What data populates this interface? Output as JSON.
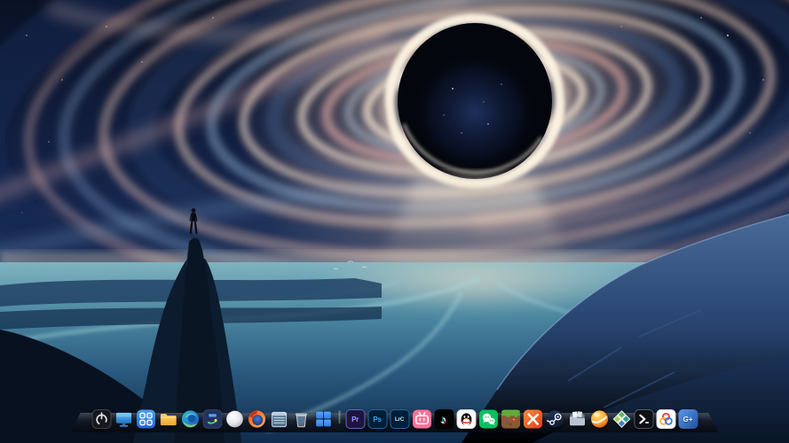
{
  "wallpaper": {
    "description": "Interstellar-style painted black hole with swirling pink and cream accretion disk over a blue valley; lone human silhouette standing on a rock spire at left, dark mountains at right",
    "colors": {
      "sky": "#101c38",
      "accretion_pink": "#e8a9a5",
      "accretion_cream": "#f6e9d4",
      "accretion_blue": "#9dbede",
      "black_hole_core": "#04060d",
      "horizon_glow": "#ead9c2",
      "water": "#4d89a2",
      "mountains": "#22406b",
      "silhouette": "#070c16"
    }
  },
  "dock": {
    "background": "rgba(18,22,32,0.88)",
    "items": [
      {
        "id": "power",
        "label": "Power",
        "color": "#17181d"
      },
      {
        "id": "this-pc",
        "label": "Computer Display",
        "color": "#3aa0e8"
      },
      {
        "id": "launcher",
        "label": "App Launcher",
        "color": "#2f7ce0"
      },
      {
        "id": "file-explorer",
        "label": "File Explorer",
        "color": "#f5b942"
      },
      {
        "id": "edge",
        "label": "Microsoft Edge",
        "color": "#1b6fd4"
      },
      {
        "id": "media-player",
        "label": "Media Player",
        "color": "#20335e"
      },
      {
        "id": "white-sphere",
        "label": "Sphere App",
        "color": "#e8eaee"
      },
      {
        "id": "firefox",
        "label": "Firefox Browser",
        "color": "#ff7f27"
      },
      {
        "id": "cabinet",
        "label": "Cabinet Utility",
        "color": "#9ecbe8"
      },
      {
        "id": "recycle-bin",
        "label": "Recycle Bin",
        "color": "#bdd3e2"
      },
      {
        "id": "windows",
        "label": "Windows",
        "color": "#3b82e8"
      },
      {
        "id": "premiere",
        "label": "Adobe Premiere Pro",
        "glyph": "Pr",
        "color": "#9b9bff",
        "bg": "#1d1540"
      },
      {
        "id": "photoshop",
        "label": "Adobe Photoshop",
        "glyph": "Ps",
        "color": "#31a8ff",
        "bg": "#001e36"
      },
      {
        "id": "lightroom-classic",
        "label": "Adobe Lightroom Classic",
        "glyph": "LrC",
        "color": "#b8e0fa",
        "bg": "#001e36"
      },
      {
        "id": "bilibili",
        "label": "bilibili",
        "color": "#fb7299"
      },
      {
        "id": "douyin",
        "label": "Douyin / TikTok",
        "glyph": "♪",
        "color": "#030304"
      },
      {
        "id": "qq",
        "label": "QQ",
        "color": "#ffffff"
      },
      {
        "id": "wechat",
        "label": "WeChat",
        "color": "#07c160"
      },
      {
        "id": "pixel-game",
        "label": "Pixel Game",
        "color": "#8a5a32"
      },
      {
        "id": "orange-utility",
        "label": "Orange Utility",
        "color": "#e8451f"
      },
      {
        "id": "steam",
        "label": "Steam",
        "color": "#1b2838"
      },
      {
        "id": "documents-folder",
        "label": "Documents Folder",
        "color": "#aab4c4"
      },
      {
        "id": "orange-sphere",
        "label": "Orange Sphere App",
        "color": "#f07818"
      },
      {
        "id": "diamond-tiles",
        "label": "Diamond Tiles App",
        "color": "#2f9d8f"
      },
      {
        "id": "dev-terminal",
        "label": "Terminal App",
        "color": "#0d0f14"
      },
      {
        "id": "tri-circles",
        "label": "Tri-circle App",
        "color": "#ffffff"
      },
      {
        "id": "g-plus",
        "label": "G+",
        "glyph": "G+",
        "color": "#3a7bd5"
      }
    ]
  }
}
